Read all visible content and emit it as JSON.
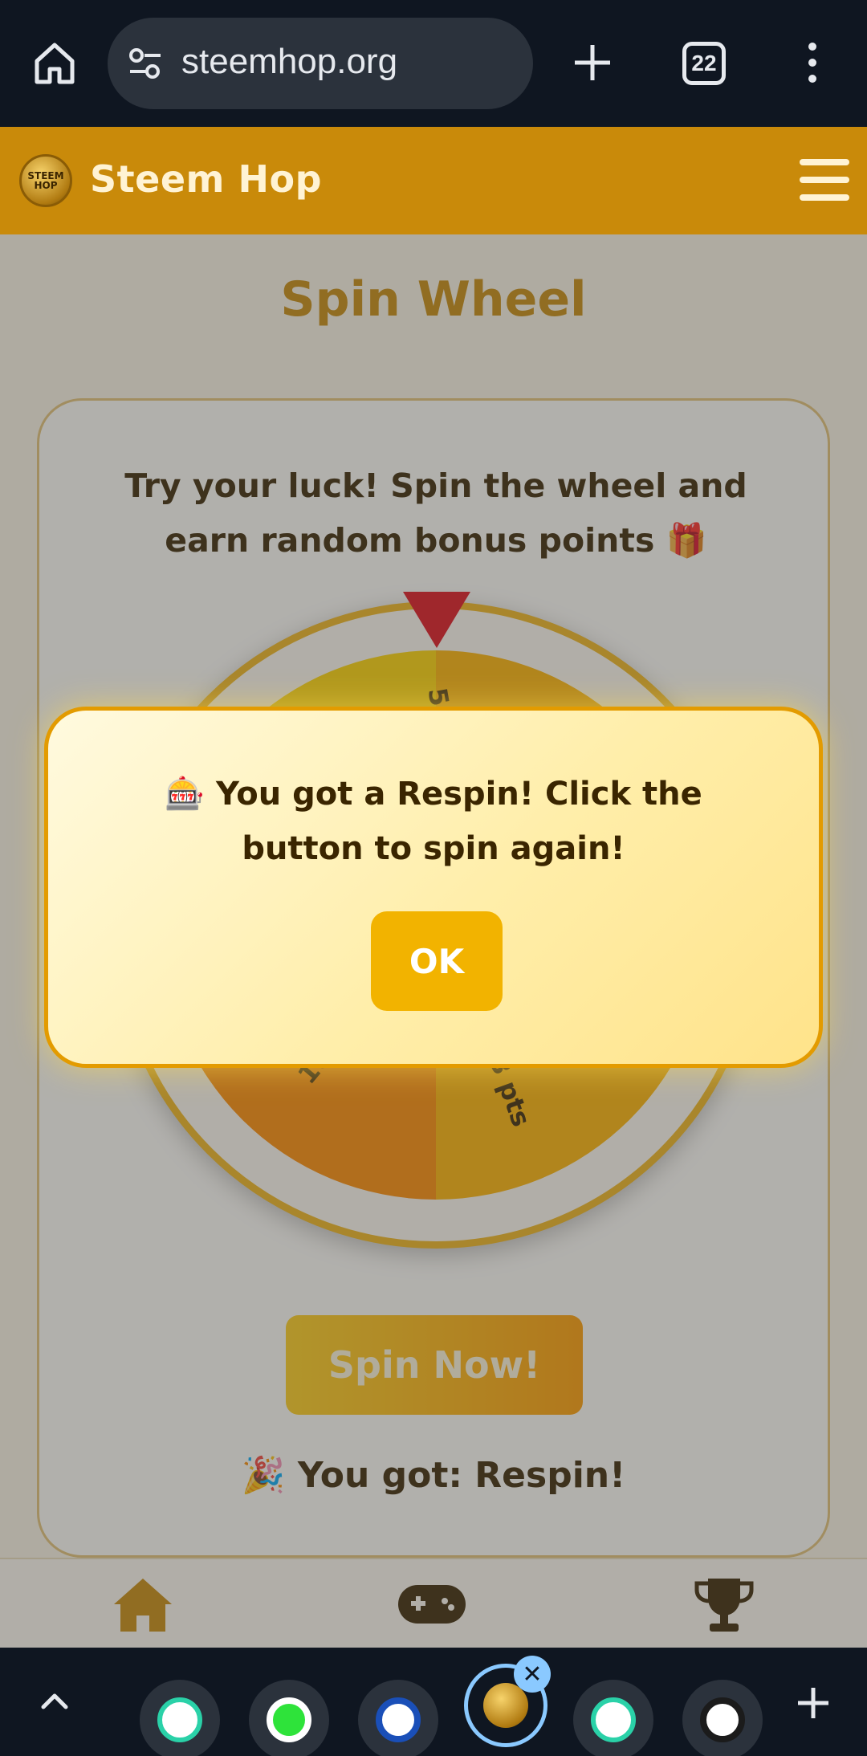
{
  "browser": {
    "url": "steemhop.org",
    "tab_count": "22"
  },
  "site": {
    "brand": "Steem Hop",
    "logo_text": "STEEM HOP"
  },
  "page": {
    "title": "Spin Wheel",
    "description": "Try your luck! Spin the wheel and earn random bonus points 🎁",
    "wheel_labels": [
      "333 pts",
      "5",
      "10"
    ],
    "spin_button": "Spin Now!",
    "result": "🎉 You got: Respin!"
  },
  "modal": {
    "message": "🎰 You got a Respin! Click the button to spin again!",
    "ok_button": "OK"
  },
  "bottom_nav": {
    "items": [
      "home-icon",
      "gamepad-icon",
      "trophy-icon"
    ]
  },
  "colors": {
    "header": "#c98a0a",
    "accent": "#f2b300",
    "pointer": "#e0121a"
  }
}
